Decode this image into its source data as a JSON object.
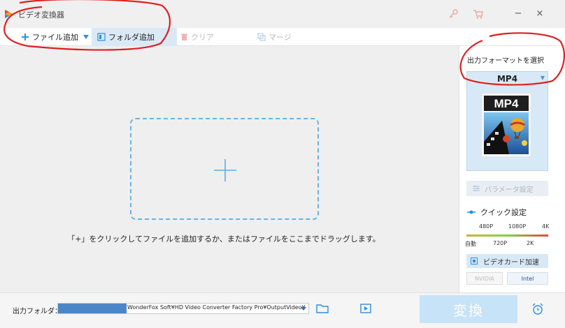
{
  "window": {
    "title": "ビデオ変換器",
    "icons": [
      "key-icon",
      "cart-icon"
    ],
    "minimize": "−",
    "close": "×"
  },
  "toolbar": {
    "add_file": "ファイル追加",
    "add_folder": "フォルダ追加",
    "clear": "クリア",
    "merge": "マージ"
  },
  "drop_zone": {
    "hint": "「+」をクリックしてファイルを追加するか、またはファイルをここまでドラッグします。"
  },
  "format_panel": {
    "title": "出力フォーマットを選択",
    "selected_format": "MP4",
    "format_icon_label": "MP4",
    "param_button": "パラメータ設定",
    "quick_settings": "クイック設定",
    "quality_top": [
      "480P",
      "1080P",
      "4K"
    ],
    "quality_bottom": [
      "自動",
      "720P",
      "2K"
    ],
    "gpu_accel": "ビデオカード加速",
    "gpu_vendors": [
      "NVIDIA",
      "Intel"
    ]
  },
  "bottom": {
    "output_label": "出力フォルダ：",
    "output_path": "WonderFox Soft¥HD Video Converter Factory Pro¥OutputVideo¥",
    "convert": "変換"
  },
  "colors": {
    "accent": "#2d8ee0",
    "selected_bg": "#dbe8f6",
    "convert_bg": "#c7e3f7",
    "annotation": "#e02020"
  }
}
